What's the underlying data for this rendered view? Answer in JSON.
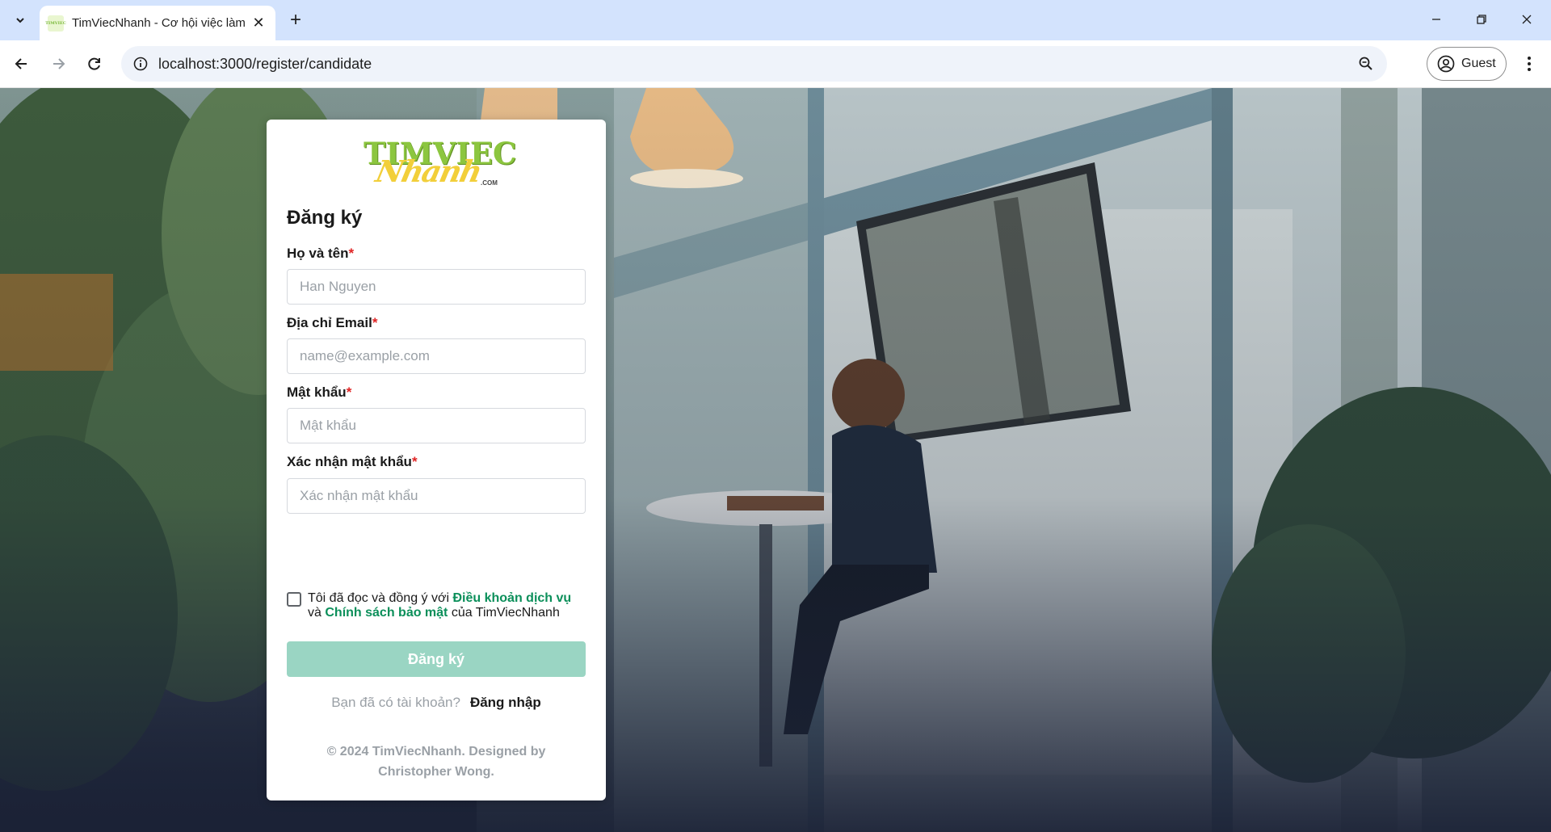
{
  "browser": {
    "tab_title": "TimViecNhanh - Cơ hội việc làm",
    "favicon_text": "TIMVIEC",
    "url": "localhost:3000/register/candidate",
    "profile_label": "Guest",
    "icons": [
      "tab-search-icon",
      "close-icon",
      "plus-icon",
      "minimize-icon",
      "restore-icon",
      "back-arrow-icon",
      "forward-arrow-icon",
      "reload-icon",
      "info-icon",
      "zoom-icon",
      "profile-icon",
      "kebab-menu-icon"
    ]
  },
  "logo": {
    "top": "TIMVIEC",
    "script": "Nhanh",
    "suffix": ".COM",
    "colors": {
      "green": "#8cc63f",
      "yellow": "#f2cf3a"
    }
  },
  "form": {
    "heading": "Đăng ký",
    "required_mark": "*",
    "fields": [
      {
        "label": "Họ và tên",
        "placeholder": "Han Nguyen",
        "value": ""
      },
      {
        "label": "Địa chỉ Email",
        "placeholder": "name@example.com",
        "value": ""
      },
      {
        "label": "Mật khẩu",
        "placeholder": "Mật khẩu",
        "value": ""
      },
      {
        "label": "Xác nhận mật khẩu",
        "placeholder": "Xác nhận mật khẩu",
        "value": ""
      }
    ],
    "terms": {
      "checked": false,
      "prefix": "Tôi đã đọc và đồng ý với",
      "terms_link": "Điều khoản dịch vụ",
      "and": "và",
      "privacy_link": "Chính sách bảo mật",
      "suffix": "của TimViecNhanh"
    },
    "submit_label": "Đăng ký",
    "login_question": "Bạn đã có tài khoản?",
    "login_link": "Đăng nhập",
    "footer": "© 2024 TimViecNhanh. Designed by Christopher Wong."
  },
  "colors": {
    "accent": "#0b8f5a",
    "submit_disabled": "#9ad5c3",
    "required": "#e02424",
    "chrome_tabbar": "#d3e3fd"
  }
}
